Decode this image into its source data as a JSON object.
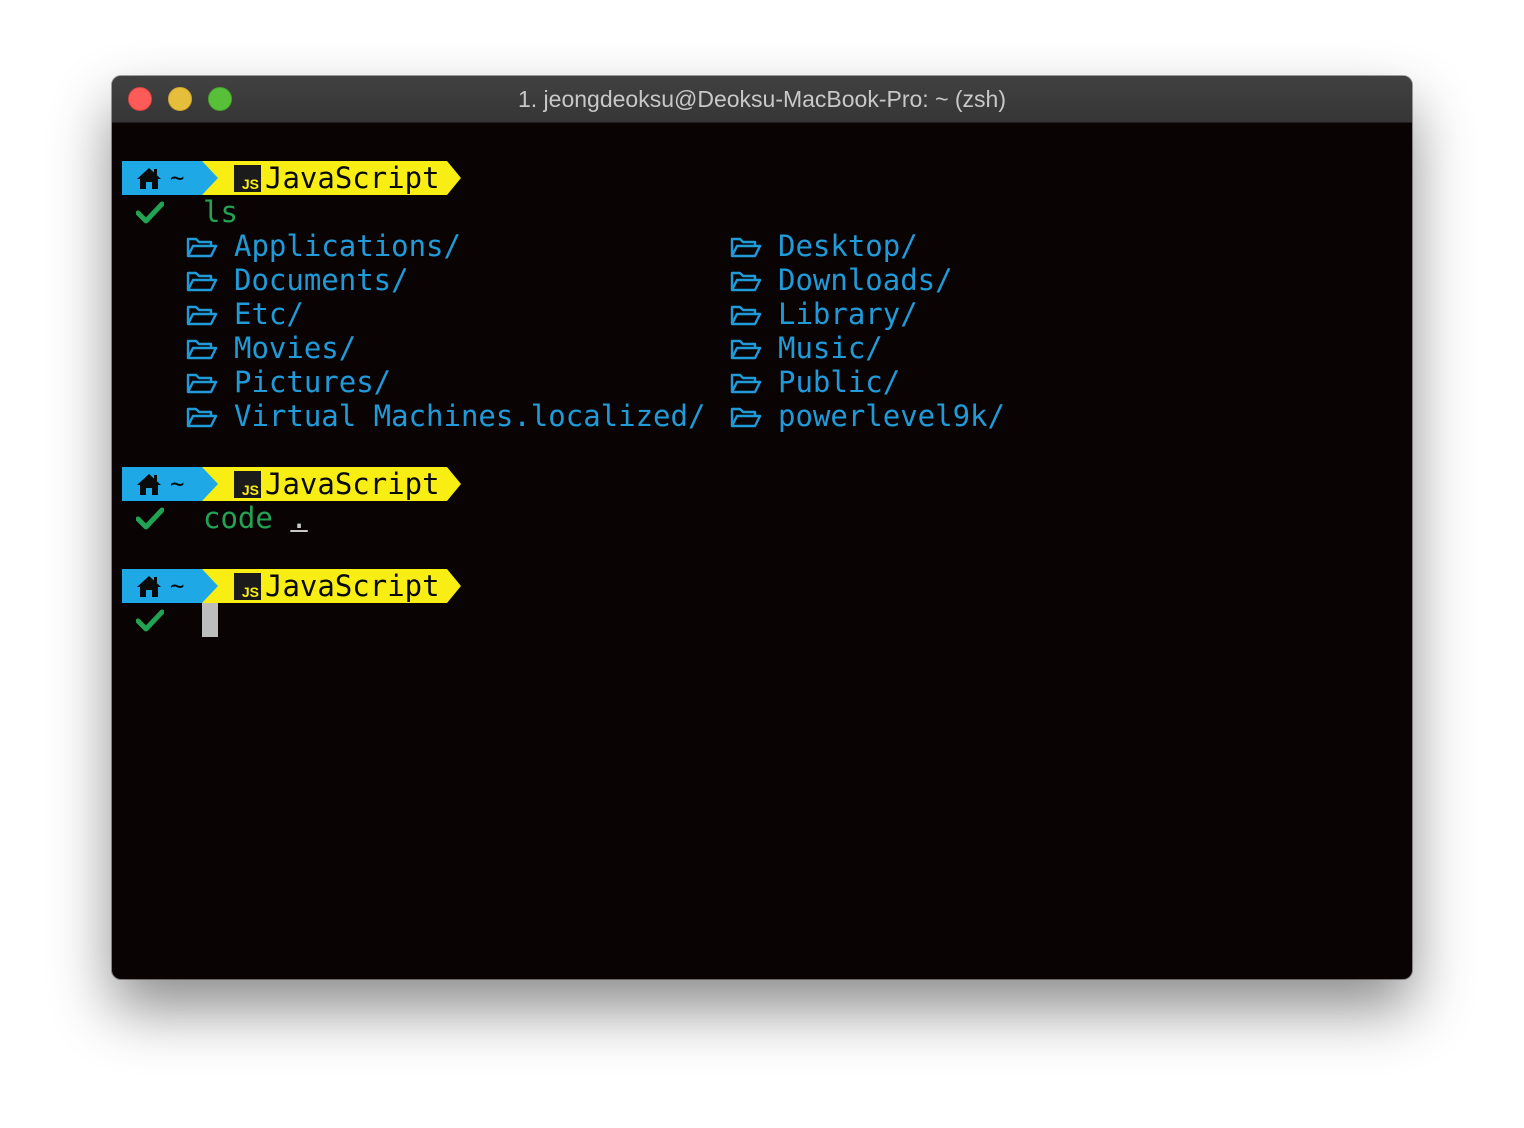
{
  "window": {
    "title": "1. jeongdeoksu@Deoksu-MacBook-Pro: ~ (zsh)",
    "buttons": [
      "close",
      "minimize",
      "zoom"
    ]
  },
  "colors": {
    "background": "#090403",
    "prompt_home": "#1ea8e6",
    "prompt_js": "#f8ee14",
    "command": "#22a354",
    "directory": "#209ad8",
    "cursor": "#bdbdbd"
  },
  "prompt": {
    "home_icon": "home-icon",
    "dir": "~",
    "js_badge": "JS",
    "lang": "JavaScript",
    "status_icon": "check-icon"
  },
  "blocks": [
    {
      "command": "ls"
    },
    {
      "command": "code",
      "arg": "."
    },
    {
      "command": ""
    }
  ],
  "ls_output": {
    "icon": "folder-open-icon",
    "left": [
      "Applications/",
      "Documents/",
      "Etc/",
      "Movies/",
      "Pictures/",
      "Virtual Machines.localized/"
    ],
    "right": [
      "Desktop/",
      "Downloads/",
      "Library/",
      "Music/",
      "Public/",
      "powerlevel9k/"
    ]
  }
}
